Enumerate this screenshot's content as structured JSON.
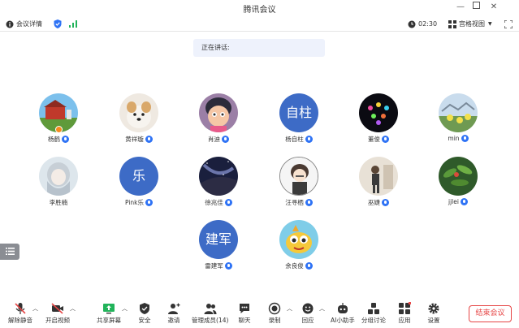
{
  "window": {
    "title": "腾讯会议"
  },
  "infobar": {
    "meeting_details": "会议详情",
    "timer": "02:30",
    "view_mode": "宫格视图"
  },
  "speaking": {
    "label": "正在讲话:"
  },
  "participants": [
    {
      "name": "杨鹤",
      "avatar": "photo-farm"
    },
    {
      "name": "黄祥璇",
      "avatar": "photo-dog"
    },
    {
      "name": "肖迪",
      "avatar": "photo-cartoon"
    },
    {
      "name": "杨自柱",
      "avatar_text": "自柱"
    },
    {
      "name": "董俊",
      "avatar": "photo-lights"
    },
    {
      "name": "min",
      "avatar": "photo-flowers"
    },
    {
      "name": "李胜楠",
      "avatar": "photo-anime"
    },
    {
      "name": "Pink乐",
      "avatar_text": "乐"
    },
    {
      "name": "徐兆佳",
      "avatar": "photo-galaxy"
    },
    {
      "name": "汪寻栖",
      "avatar": "photo-chibi"
    },
    {
      "name": "巫婕",
      "avatar": "photo-sketch"
    },
    {
      "name": "jjlei",
      "avatar": "photo-plant"
    },
    {
      "name": "雷建军",
      "avatar_text": "建军"
    },
    {
      "name": "余良俊",
      "avatar": "photo-fish"
    }
  ],
  "toolbar": {
    "unmute": "解除静音",
    "start_video": "开启视频",
    "share_screen": "共享屏幕",
    "security": "安全",
    "invite": "邀请",
    "manage_members": "管理成员(14)",
    "chat": "聊天",
    "record": "录制",
    "reactions": "回应",
    "ai_assistant": "AI小助手",
    "breakout": "分组讨论",
    "apps": "应用",
    "settings": "设置",
    "end_meeting": "结束会议"
  }
}
